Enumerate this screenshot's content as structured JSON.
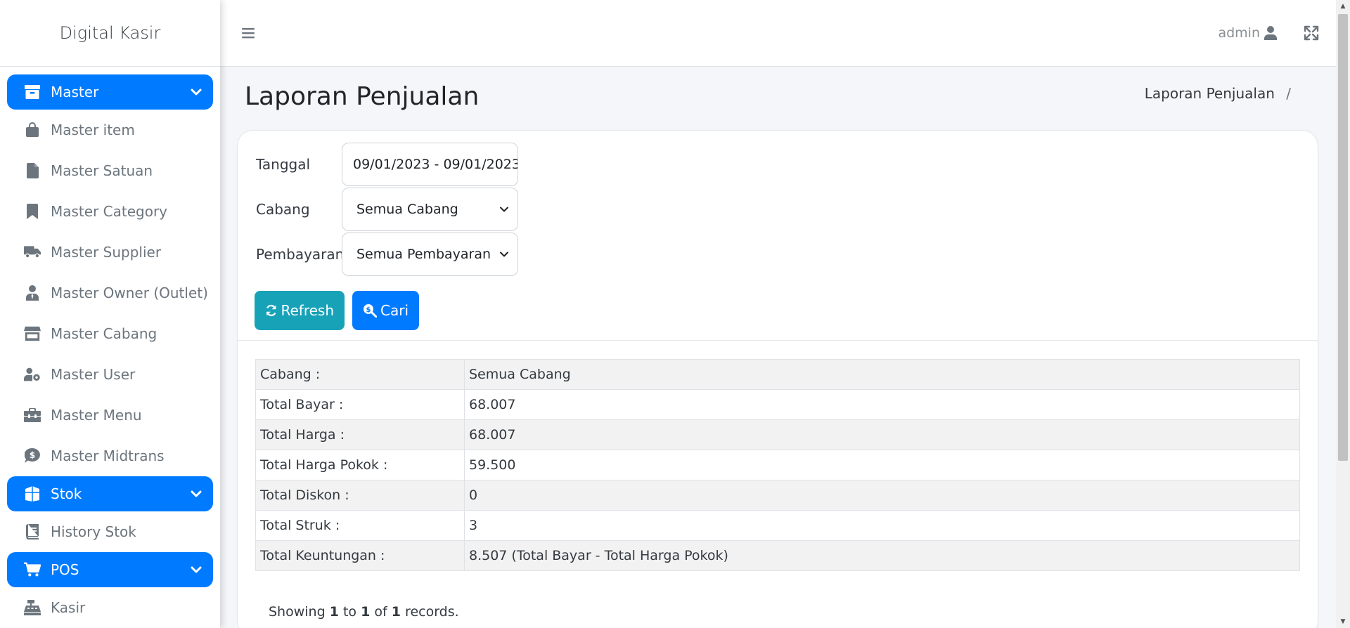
{
  "app": {
    "brand": "Digital Kasir"
  },
  "sidebar": {
    "groups": [
      {
        "label": "Master",
        "items": [
          {
            "label": "Master item"
          },
          {
            "label": "Master Satuan"
          },
          {
            "label": "Master Category"
          },
          {
            "label": "Master Supplier"
          },
          {
            "label": "Master Owner (Outlet)"
          },
          {
            "label": "Master Cabang"
          },
          {
            "label": "Master User"
          },
          {
            "label": "Master Menu"
          },
          {
            "label": "Master Midtrans"
          }
        ]
      },
      {
        "label": "Stok",
        "items": [
          {
            "label": "History Stok"
          }
        ]
      },
      {
        "label": "POS",
        "items": [
          {
            "label": "Kasir"
          }
        ]
      }
    ]
  },
  "topbar": {
    "user": "admin"
  },
  "page": {
    "title": "Laporan Penjualan",
    "breadcrumb": "Laporan Penjualan",
    "breadcrumb_sep": "/"
  },
  "filters": {
    "tanggal": {
      "label": "Tanggal",
      "value": "09/01/2023 - 09/01/2023"
    },
    "cabang": {
      "label": "Cabang",
      "value": "Semua Cabang"
    },
    "pembayaran": {
      "label": "Pembayaran",
      "value": "Semua Pembayaran"
    }
  },
  "buttons": {
    "refresh": "Refresh",
    "cari": "Cari"
  },
  "summary": [
    {
      "key": "Cabang :",
      "value": "Semua Cabang"
    },
    {
      "key": "Total Bayar :",
      "value": "68.007"
    },
    {
      "key": "Total Harga :",
      "value": "68.007"
    },
    {
      "key": "Total Harga Pokok :",
      "value": "59.500"
    },
    {
      "key": "Total Diskon :",
      "value": "0"
    },
    {
      "key": "Total Struk :",
      "value": "3"
    },
    {
      "key": "Total Keuntungan :",
      "value": "8.507 (Total Bayar - Total Harga Pokok)"
    }
  ],
  "showing": {
    "pre": "Showing",
    "from": "1",
    "to_word": "to",
    "to": "1",
    "of_word": "of",
    "total": "1",
    "post": "records."
  },
  "colors": {
    "primary": "#007bff",
    "info": "#17a2b8",
    "muted": "#6c757d"
  }
}
